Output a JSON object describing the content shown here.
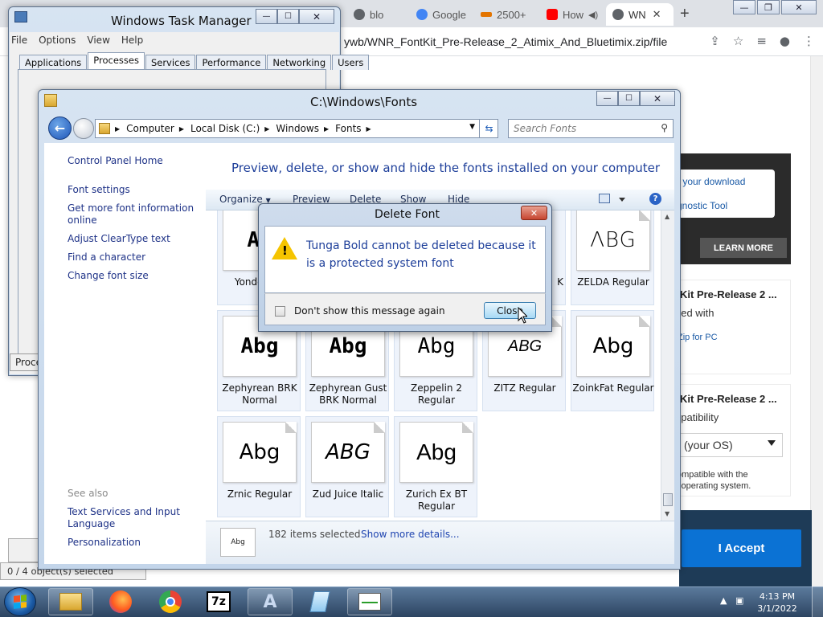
{
  "browser": {
    "tabs": [
      {
        "label": "blo",
        "color": "#5f6368"
      },
      {
        "label": "Google",
        "color": "#4285f4"
      },
      {
        "label": "2500+",
        "color": "#e37400"
      },
      {
        "label": "How",
        "color": "#ff0000"
      },
      {
        "label": "WN",
        "color": "#5f6368"
      }
    ],
    "url": "ywb/WNR_FontKit_Pre-Release_2_Atimix_And_Bluetimix.zip/file",
    "page": {
      "download_text": "r your download",
      "diagnostic_text": "gnostic Tool",
      "learn_more": "LEARN MORE",
      "card1_title": "Kit Pre-Release 2 ...",
      "card1_text": "ned with",
      "card1_link": "Zip for PC",
      "card2_title": "Kit Pre-Release 2 ...",
      "card2_text": "npatibility",
      "os_select": "(your OS)",
      "note1": "ompatible with the",
      "note2": "l operating system.",
      "accept": "I Accept"
    }
  },
  "taskmgr": {
    "title": "Windows Task Manager",
    "menu": [
      "File",
      "Options",
      "View",
      "Help"
    ],
    "tabs": [
      "Applications",
      "Processes",
      "Services",
      "Performance",
      "Networking",
      "Users"
    ],
    "active_tab": "Processes",
    "status": "0 / 4 object(s) selected",
    "proc_button": "Proce"
  },
  "fonts_window": {
    "title": "C:\\Windows\\Fonts",
    "breadcrumb": [
      "Computer",
      "Local Disk (C:)",
      "Windows",
      "Fonts"
    ],
    "search_placeholder": "Search Fonts",
    "left_links": [
      "Control Panel Home",
      "Font settings",
      "Get more font information online",
      "Adjust ClearType text",
      "Find a character",
      "Change font size"
    ],
    "see_also_label": "See also",
    "see_also_links": [
      "Text Services and Input Language",
      "Personalization"
    ],
    "header": "Preview, delete, or show and hide the fonts installed on your computer",
    "toolbar": [
      "Organize",
      "Preview",
      "Delete",
      "Show",
      "Hide"
    ],
    "tiles": [
      {
        "name": "Yonde Reg",
        "sample": "Ab"
      },
      {
        "name": "ZELDA Regular",
        "sample": "ΛBG"
      },
      {
        "name": "Zephyrean BRK Normal",
        "sample": "Abg"
      },
      {
        "name": "Zephyrean Gust BRK Normal",
        "sample": "Abg"
      },
      {
        "name": "Zeppelin 2 Regular",
        "sample": "Abg"
      },
      {
        "name": "ZITZ Regular",
        "sample": "ABG"
      },
      {
        "name": "ZoinkFat Regular",
        "sample": "Abg"
      },
      {
        "name": "Zrnic Regular",
        "sample": "Abg"
      },
      {
        "name": "Zud Juice Italic",
        "sample": "ABG"
      },
      {
        "name": "Zurich Ex BT Regular",
        "sample": "Abg"
      }
    ],
    "partial_tile_label": "K",
    "details": {
      "count": "182 items selected",
      "link": "Show more details...",
      "thumb": "Abg"
    }
  },
  "dialog": {
    "title": "Delete Font",
    "message": "Tunga Bold cannot be deleted because it is a protected system font",
    "checkbox_label": "Don't show this message again",
    "close_button": "Close"
  },
  "taskbar": {
    "time": "4:13 PM",
    "date": "3/1/2022",
    "items": [
      "explorer",
      "firefox",
      "chrome",
      "7-zip",
      "font-tool",
      "notepad",
      "task-manager"
    ]
  }
}
